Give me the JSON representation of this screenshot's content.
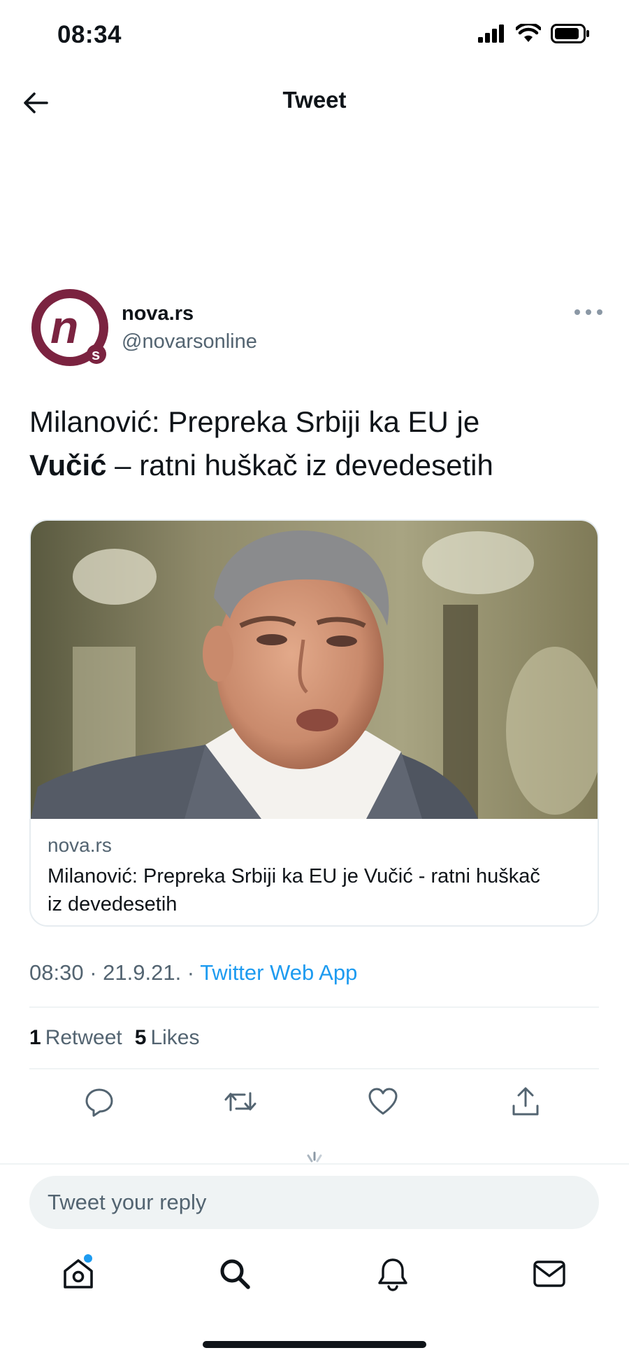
{
  "status_bar": {
    "time": "08:34"
  },
  "header": {
    "title": "Tweet"
  },
  "author": {
    "name": "nova.rs",
    "handle": "@novarsonline",
    "avatar_letters": "ns"
  },
  "tweet": {
    "text_line1": "Milanović: Prepreka Srbiji ka EU je",
    "text_bold": "Vučić",
    "text_line2_rest": " – ratni huškač iz devedesetih"
  },
  "card": {
    "image_alt": "Milanović",
    "domain": "nova.rs",
    "title": "Milanović: Prepreka Srbiji ka EU je Vučić - ratni huškač iz devedesetih"
  },
  "meta": {
    "time": "08:30",
    "date": "21.9.21.",
    "separator": " · ",
    "source": "Twitter Web App"
  },
  "stats": {
    "retweets_count": "1",
    "retweets_label": "Retweet",
    "likes_count": "5",
    "likes_label": "Likes"
  },
  "reply": {
    "placeholder": "Tweet your reply"
  },
  "icons": {
    "back": "arrow-left-icon",
    "more": "more-icon",
    "reply": "reply-icon",
    "retweet": "retweet-icon",
    "like": "heart-icon",
    "share": "share-icon",
    "home": "home-icon",
    "search": "search-icon",
    "notifications": "bell-icon",
    "messages": "mail-icon"
  },
  "colors": {
    "accent": "#1d9bf0",
    "text": "#0f1419",
    "muted": "#536471",
    "brand": "#7b2340"
  }
}
